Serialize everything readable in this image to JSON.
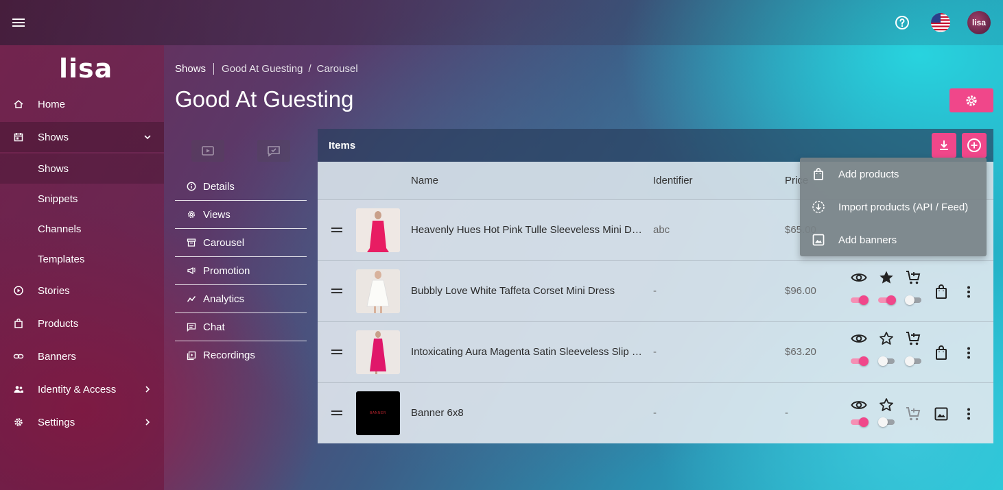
{
  "topbar": {
    "menu_icon": "hamburger-icon",
    "help_icon": "help-circle-icon",
    "flag_icon": "us-flag-icon",
    "avatar_text": "lisa"
  },
  "sidebar": {
    "logo": "lisa",
    "items": [
      {
        "label": "Home",
        "icon": "home-icon"
      },
      {
        "label": "Shows",
        "icon": "calendar-icon"
      },
      {
        "label": "Stories",
        "icon": "play-circle-icon"
      },
      {
        "label": "Products",
        "icon": "shopping-bag-icon"
      },
      {
        "label": "Banners",
        "icon": "link-icon"
      },
      {
        "label": "Identity & Access",
        "icon": "users-icon"
      },
      {
        "label": "Settings",
        "icon": "gear-icon"
      }
    ],
    "sub_items": [
      "Shows",
      "Snippets",
      "Channels",
      "Templates"
    ]
  },
  "breadcrumb": {
    "first": "Shows",
    "second": "Good At Guesting",
    "sep": "/",
    "third": "Carousel"
  },
  "page": {
    "title": "Good At Guesting"
  },
  "show_menu": {
    "items": [
      "Details",
      "Views",
      "Carousel",
      "Promotion",
      "Analytics",
      "Chat",
      "Recordings"
    ]
  },
  "panel": {
    "title": "Items",
    "columns": {
      "name": "Name",
      "identifier": "Identifier",
      "price": "Price"
    },
    "rows": [
      {
        "name": "Heavenly Hues Hot Pink Tulle Sleeveless Mini Dress",
        "identifier": "abc",
        "price": "$65.00",
        "visible": true,
        "featured": true,
        "cart": true
      },
      {
        "name": "Bubbly Love White Taffeta Corset Mini Dress",
        "identifier": "-",
        "price": "$96.00",
        "visible": true,
        "featured": true,
        "cart": false
      },
      {
        "name": "Intoxicating Aura Magenta Satin Sleeveless Slip Maxi Dress",
        "identifier": "-",
        "price": "$63.20",
        "visible": true,
        "featured": false,
        "cart": false
      },
      {
        "name": "Banner 6x8",
        "identifier": "-",
        "price": "-",
        "visible": true,
        "featured": false,
        "cart": null
      }
    ],
    "banner_thumb_text": "BANNER"
  },
  "dropdown": {
    "items": [
      "Add products",
      "Import products (API / Feed)",
      "Add banners"
    ]
  },
  "colors": {
    "accent": "#f0478a",
    "toggle_track_on": "#f58fb4",
    "toggle_track_off": "#9aa0a6"
  }
}
